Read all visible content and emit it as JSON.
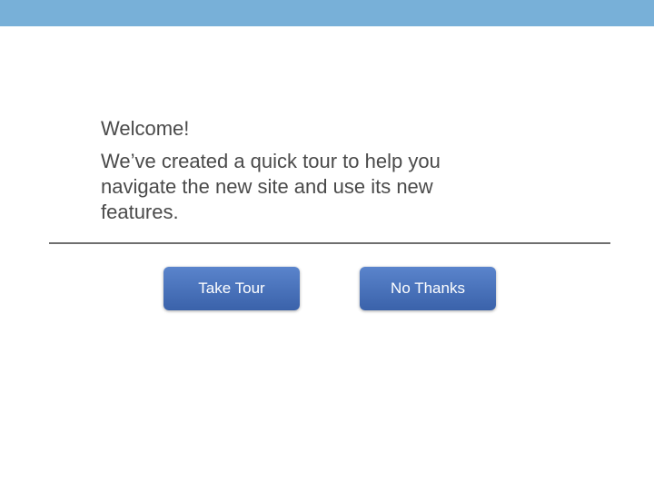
{
  "dialog": {
    "heading": "Welcome!",
    "message": "We’ve created a quick tour to help you navigate the new site and use its new features.",
    "buttons": {
      "take_tour": "Take Tour",
      "no_thanks": "No Thanks"
    }
  },
  "colors": {
    "top_bar": "#78b0d8",
    "button": "#4a72bb",
    "text": "#4a4a4a"
  }
}
